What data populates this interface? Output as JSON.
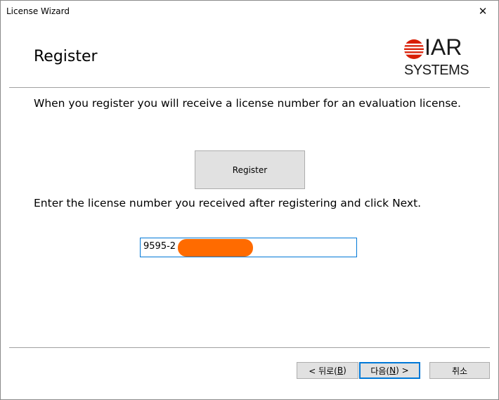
{
  "window": {
    "title": "License Wizard",
    "close_glyph": "✕"
  },
  "header": {
    "title": "Register",
    "logo": {
      "brand": "IAR",
      "subtitle": "SYSTEMS",
      "icon": "iar-logo-icon",
      "accent": "#d81e05"
    }
  },
  "content": {
    "register_info": "When you register you will receive a license number for an evaluation license.",
    "register_button": "Register",
    "license_info": "Enter the license number you received after registering and click Next.",
    "license_value": "9595-2",
    "redaction_color": "#ff6b00"
  },
  "footer": {
    "back": {
      "prefix": "< 뒤로(",
      "key": "B",
      "suffix": ")"
    },
    "next": {
      "prefix": "다음(",
      "key": "N",
      "suffix": ") >"
    },
    "cancel": "취소"
  }
}
